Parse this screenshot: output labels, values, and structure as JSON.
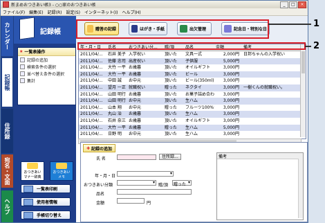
{
  "window": {
    "title": "新まめおつきあい帳3 - ○○家のおつきあい帳"
  },
  "menu": [
    "ファイル(F)",
    "編集(E)",
    "記録(R)",
    "設定(S)",
    "インターネット(I)",
    "ヘルプ(H)"
  ],
  "side_tabs": [
    "カレンダー",
    "記録帳",
    "住所録",
    "宛名・文面",
    "ヘルプ"
  ],
  "logo_title": "記録帳",
  "ops": {
    "header": "一覧表操作",
    "items": [
      "記録の追加",
      "検索条件の選択",
      "並べ替え条件の選択",
      "集計"
    ]
  },
  "big_buttons": [
    "おつきあい\nマナー辞典",
    "おつきあい\nメモ"
  ],
  "wide_buttons": [
    "一覧表印刷",
    "使用者情報",
    "手帳切り替え"
  ],
  "top_tabs": [
    {
      "label": "贈答の記録",
      "active": true
    },
    {
      "label": "はがき・手紙",
      "active": false
    },
    {
      "label": "出欠管理",
      "active": false
    },
    {
      "label": "記念日・特別な日",
      "active": false
    }
  ],
  "table": {
    "columns": [
      "年・月・日",
      "氏名",
      "おつきあい分...",
      "贈/頂",
      "品名",
      "金額",
      "備考"
    ],
    "rows": [
      [
        "2011/04/...",
        "石井 美子",
        "入学祝い",
        "頂いた",
        "文具一式",
        "2,000円",
        "日邦ちゃんの入学祝い"
      ],
      [
        "2011/04/...",
        "佐藤 忠司",
        "出産祝い",
        "頂いた",
        "子供服",
        "5,000円",
        ""
      ],
      [
        "2011/04/...",
        "大竹 一平",
        "お歳暮",
        "頂いた",
        "オイルギフト",
        "3,000円",
        ""
      ],
      [
        "2011/04/...",
        "大竹 一平",
        "お歳暮",
        "頂いた",
        "ビール",
        "3,000円",
        ""
      ],
      [
        "2011/04/...",
        "中田 誠",
        "お中元",
        "頂いた",
        "ビール(350ml)",
        "3,000円",
        ""
      ],
      [
        "2011/04/...",
        "望月 一正",
        "就職祝い",
        "贈った",
        "ネクタイ",
        "3,000円",
        "一樹くんの就職祝い。"
      ],
      [
        "2011/04/...",
        "山田 明行",
        "お歳暮",
        "頂いた",
        "お菓子詰め合わせ",
        "3,000円",
        ""
      ],
      [
        "2011/04/...",
        "山田 明行",
        "お中元",
        "頂いた",
        "生ハム",
        "3,000円",
        ""
      ],
      [
        "2011/04/...",
        "山本 翔",
        "お中元",
        "贈った",
        "フルーツ100%ジ",
        "3,000円",
        ""
      ],
      [
        "2011/04/...",
        "丸山 治",
        "お歳暮",
        "頂いた",
        "生ハム",
        "3,000円",
        ""
      ],
      [
        "2011/04/...",
        "石井 奈三",
        "お歳暮",
        "頂いた",
        "オイルギフト",
        "3,000円",
        ""
      ],
      [
        "2011/04/...",
        "大竹 一平",
        "お歳暮",
        "贈った",
        "生ハム",
        "5,000円",
        ""
      ],
      [
        "2011/04/...",
        "日野 明",
        "お中元",
        "頂いた",
        "生ハム",
        "3,000円",
        ""
      ]
    ]
  },
  "form": {
    "header": "記録の追加",
    "name_label": "氏 名",
    "addressbook_button": "住所録...",
    "date_label": "年・月・日",
    "category_label": "おつきあい分類",
    "give_receive_label": "贈/頂",
    "give_receive_value": "贈った",
    "item_label": "品名",
    "amount_label": "金額",
    "amount_unit": "円",
    "notes_label": "備考"
  },
  "callouts": [
    "1",
    "2"
  ],
  "colors": {
    "accent": "#1f3e8a",
    "callout": "#d8202a",
    "row_alt": "#d5dcf1"
  }
}
